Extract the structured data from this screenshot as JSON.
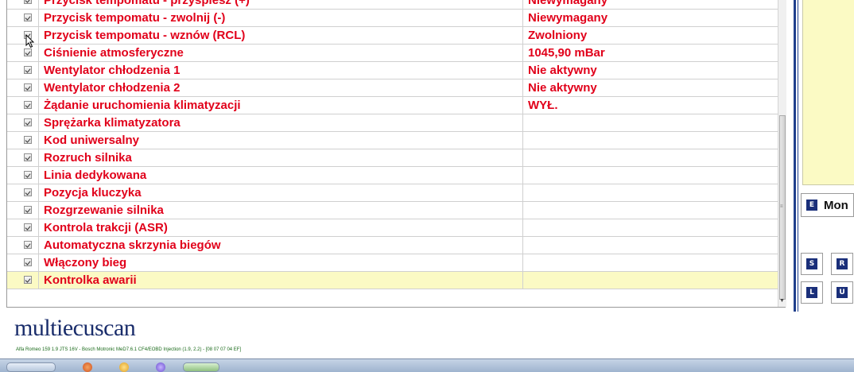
{
  "params": [
    {
      "name": "Przycisk tempomatu - przyspiesz (+)",
      "value": "Niewymagany"
    },
    {
      "name": "Przycisk tempomatu - zwolnij (-)",
      "value": "Niewymagany"
    },
    {
      "name": "Przycisk tempomatu - wznów (RCL)",
      "value": "Zwolniony"
    },
    {
      "name": "Ciśnienie atmosferyczne",
      "value": "1045,90 mBar"
    },
    {
      "name": "Wentylator chłodzenia 1",
      "value": "Nie aktywny"
    },
    {
      "name": "Wentylator chłodzenia 2",
      "value": "Nie aktywny"
    },
    {
      "name": "Żądanie uruchomienia klimatyzacji",
      "value": "WYŁ."
    },
    {
      "name": "Sprężarka klimatyzatora",
      "value": ""
    },
    {
      "name": "Kod uniwersalny",
      "value": ""
    },
    {
      "name": "Rozruch silnika",
      "value": ""
    },
    {
      "name": "Linia dedykowana",
      "value": ""
    },
    {
      "name": "Pozycja kluczyka",
      "value": ""
    },
    {
      "name": "Rozgrzewanie silnika",
      "value": ""
    },
    {
      "name": "Kontrola trakcji (ASR)",
      "value": ""
    },
    {
      "name": "Automatyczna skrzynia biegów",
      "value": ""
    },
    {
      "name": "Włączony bieg",
      "value": ""
    },
    {
      "name": "Kontrolka awarii",
      "value": ""
    }
  ],
  "selected_row_index": 16,
  "side_panel": {
    "monitor_key": "E",
    "monitor_label": "Mon",
    "keys_row1": [
      "S",
      "R"
    ],
    "keys_row2": [
      "L",
      "U"
    ]
  },
  "footer": {
    "logo_text": "multiecuscan",
    "status_text": "Alfa Romeo 159 1.9 JTS 16V - Bosch Motronic MeD7.6.1 CF4/EOBD Injection (1.9, 2.2) - [08 07 07 04 EF]"
  },
  "colors": {
    "param_text": "#e1001a",
    "selected_row_bg": "#fbfac4",
    "accent_blue": "#1f3f8c",
    "logo": "#1a2d6b"
  }
}
